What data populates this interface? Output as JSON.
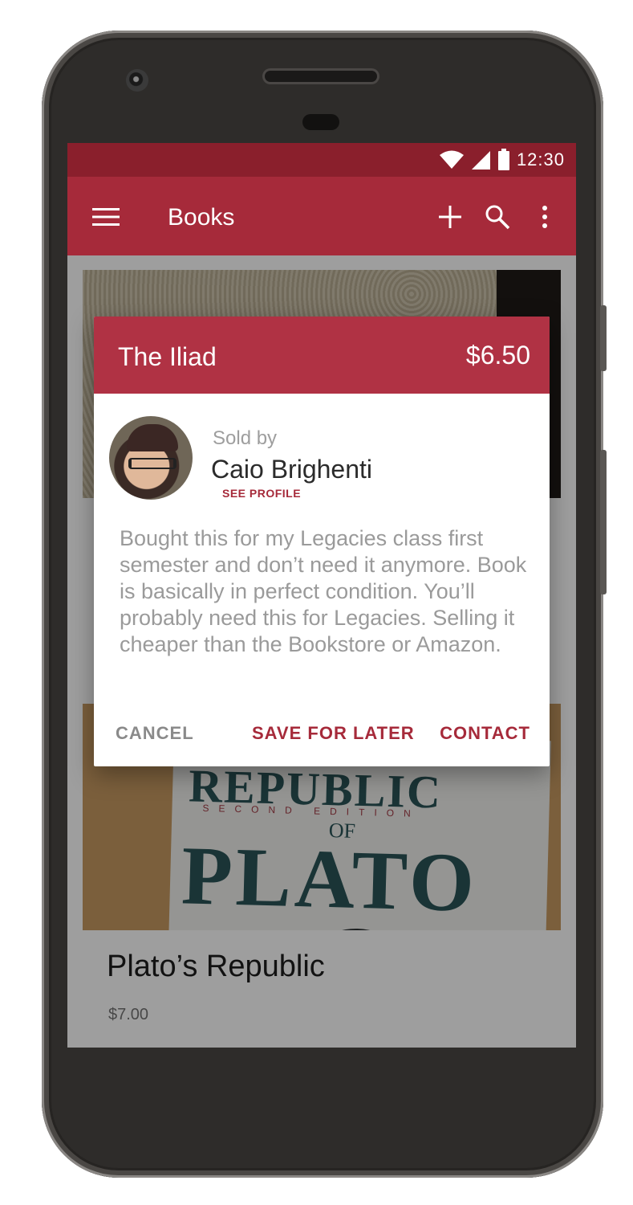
{
  "status_bar": {
    "time": "12:30"
  },
  "app_bar": {
    "title": "Books"
  },
  "colors": {
    "primary": "#a62a3a",
    "primary_dark": "#8a1f2c",
    "dialog_header": "#b03244"
  },
  "listing_card_2": {
    "name": "Plato’s Republic",
    "price": "$7.00"
  },
  "book_cover_text": {
    "line1": "REPUBLIC",
    "line2": "SECOND EDITION",
    "line3": "OF",
    "line4": "PLATO"
  },
  "dialog": {
    "title": "The Iliad",
    "price": "$6.50",
    "sold_by_label": "Sold by",
    "seller_name": "Caio Brighenti",
    "see_profile": "SEE PROFILE",
    "description": "Bought this for my Legacies class first semester and don’t need it anymore. Book is basically in perfect condition. You’ll probably need this for Legacies. Selling it cheaper than the Bookstore or Amazon.",
    "actions": {
      "cancel": "CANCEL",
      "save": "SAVE FOR LATER",
      "contact": "CONTACT"
    }
  }
}
